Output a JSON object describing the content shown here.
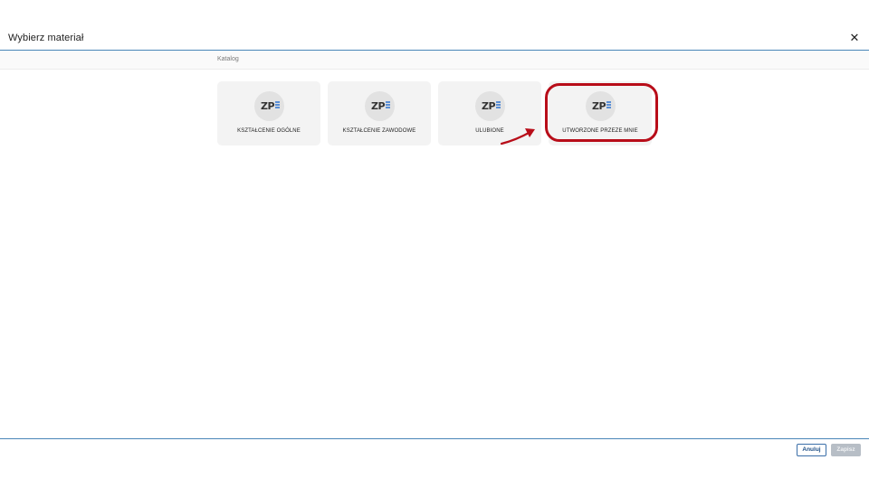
{
  "dialog": {
    "title": "Wybierz materiał",
    "close_symbol": "✕"
  },
  "breadcrumb": {
    "label": "Katalog"
  },
  "tiles": [
    {
      "label": "KSZTAŁCENIE OGÓLNE",
      "logo_text": "ZP",
      "icon": "zpe-logo-icon"
    },
    {
      "label": "KSZTAŁCENIE ZAWODOWE",
      "logo_text": "ZP",
      "icon": "zpe-logo-icon"
    },
    {
      "label": "ULUBIONE",
      "logo_text": "ZP",
      "icon": "zpe-logo-icon"
    },
    {
      "label": "UTWORZONE PRZEZE MNIE",
      "logo_text": "ZP",
      "icon": "zpe-logo-icon"
    }
  ],
  "annotation": {
    "highlight_color": "#b80d19",
    "highlighted_tile": "UTWORZONE PRZEZE MNIE"
  },
  "footer": {
    "cancel_label": "Anuluj",
    "save_label": "Zapisz"
  },
  "colors": {
    "accent_line": "#4a86b8",
    "tile_bg": "#f3f3f3",
    "save_disabled": "#b7bec6"
  }
}
